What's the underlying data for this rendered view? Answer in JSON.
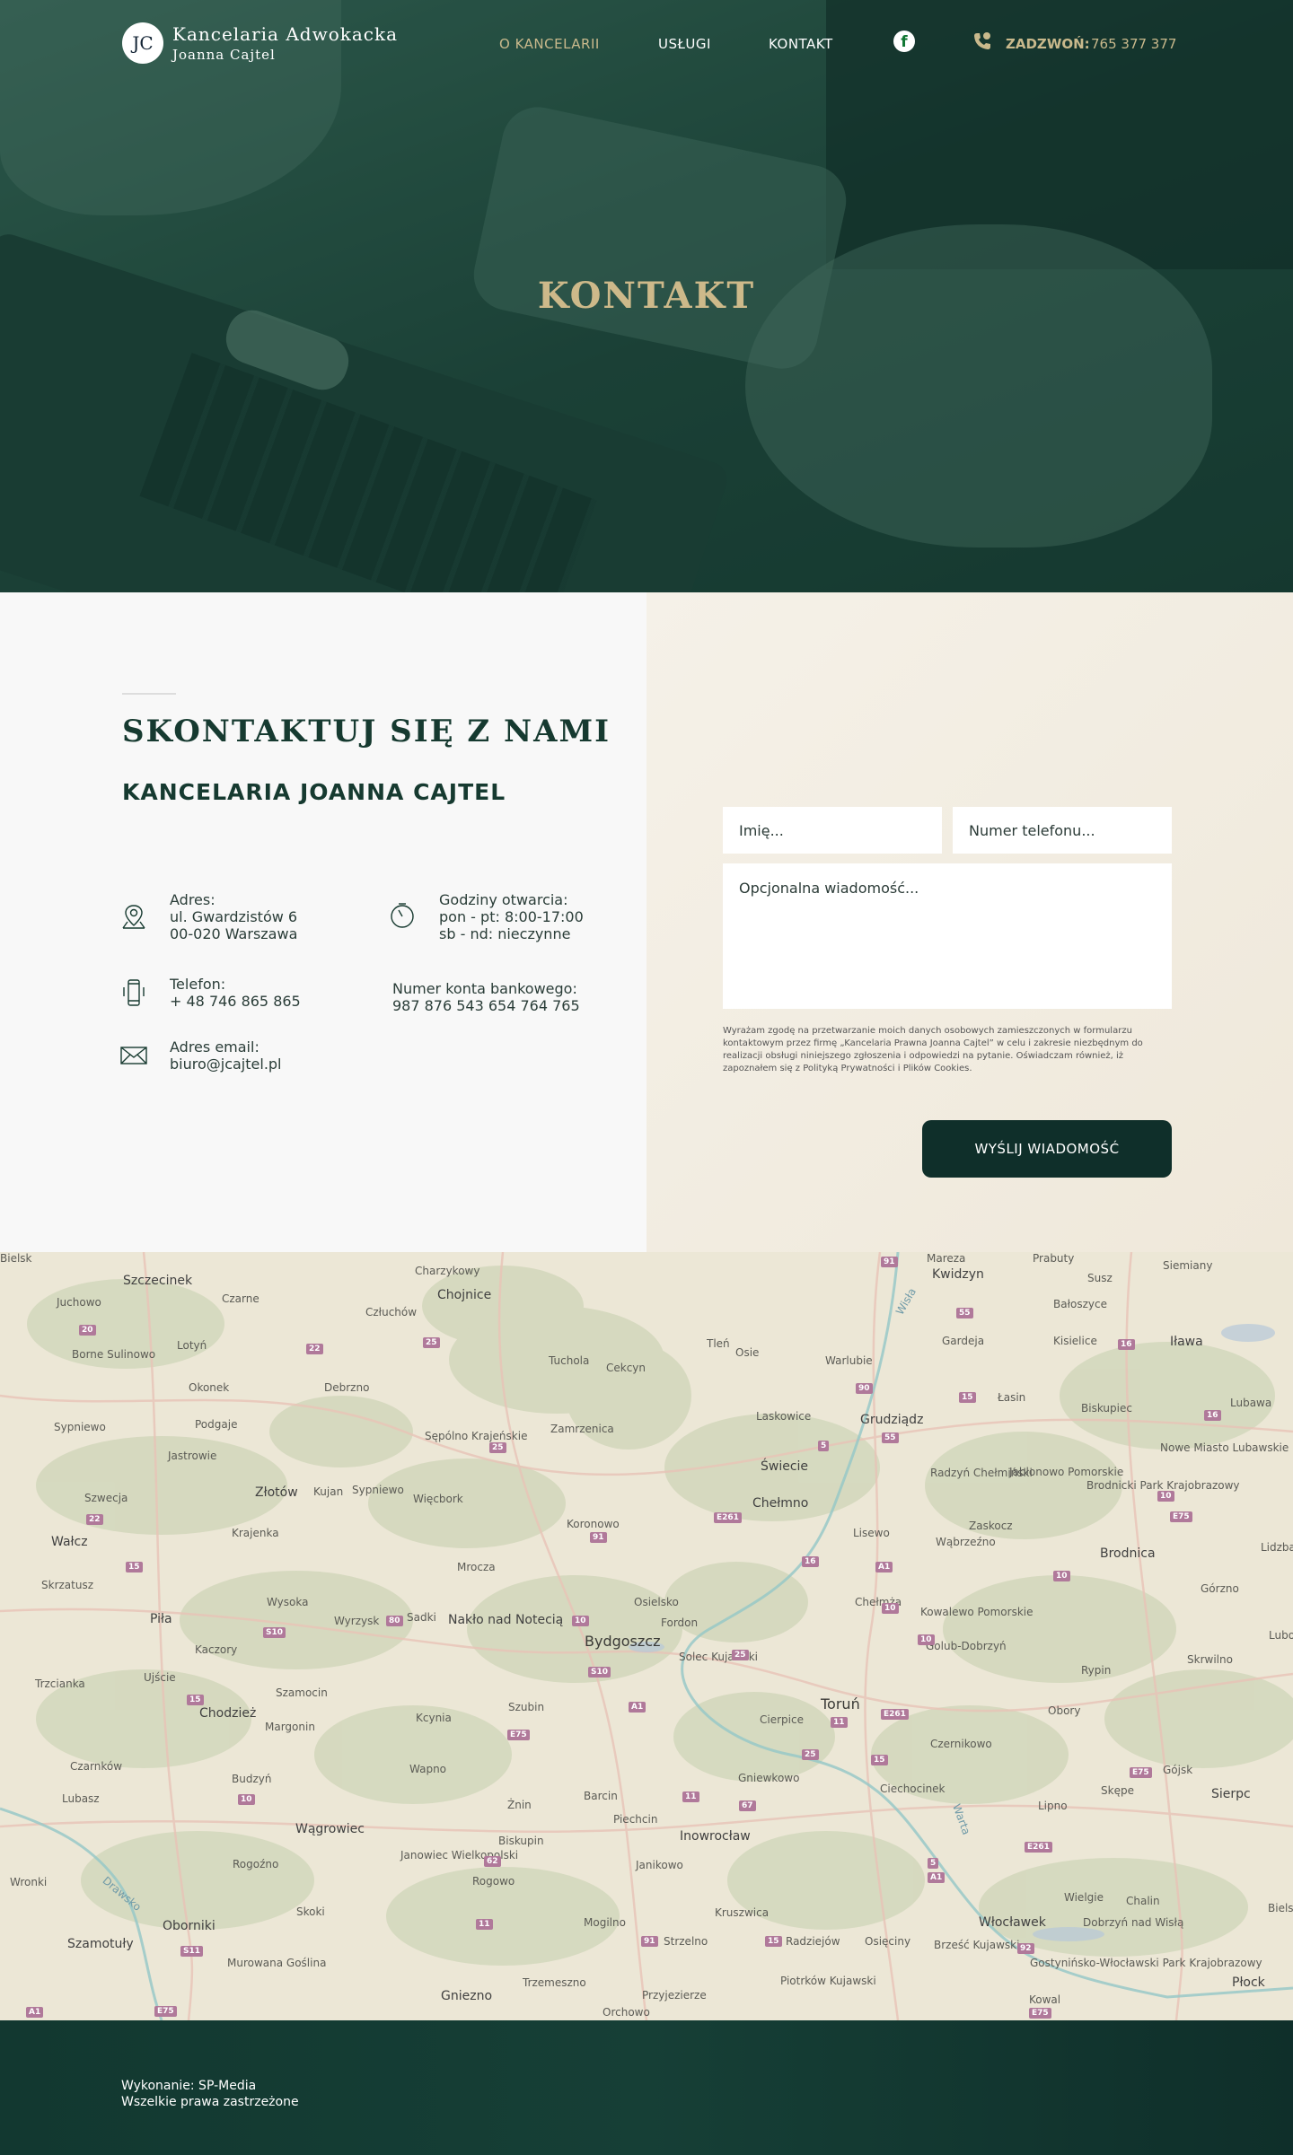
{
  "nav": {
    "logo_mark": "JC",
    "logo_line1": "Kancelaria Adwokacka",
    "logo_line2": "Joanna Cajtel",
    "links": [
      "O KANCELARII",
      "USŁUGI",
      "KONTAKT"
    ],
    "facebook_glyph": "f",
    "call_label": "ZADZWOŃ:",
    "call_number": "765 377 377"
  },
  "hero": {
    "title": "KONTAKT"
  },
  "contact": {
    "heading": "SKONTAKTUJ SIĘ Z NAMI",
    "subheading": "KANCELARIA JOANNA CAJTEL",
    "address_label": "Adres:",
    "address_line1": "ul. Gwardzistów 6",
    "address_line2": "00-020 Warszawa",
    "hours_label": "Godziny otwarcia:",
    "hours_line1": "pon - pt: 8:00-17:00",
    "hours_line2": "sb - nd: nieczynne",
    "phone_label": "Telefon:",
    "phone_value": "+ 48 746 865 865",
    "bank_label": "Numer konta bankowego:",
    "bank_value": "987 876 543 654 764 765",
    "email_label": "Adres email:",
    "email_value": "biuro@jcajtel.pl"
  },
  "form": {
    "name_placeholder": "Imię...",
    "phone_placeholder": "Numer telefonu...",
    "message_placeholder": "Opcjonalna wiadomość...",
    "consent": "Wyrażam zgodę na przetwarzanie moich danych osobowych zamieszczonych w formularzu kontaktowym przez firmę „Kancelaria Prawna Joanna Cajtel” w celu i zakresie niezbędnym do realizacji obsługi niniejszego zgłoszenia i odpowiedzi na pytanie. Oświadczam również, iż zapoznałem się z Polityką Prywatności i Plików Cookies.",
    "submit": "WYŚLIJ WIADOMOŚĆ"
  },
  "map": {
    "cities": [
      "Szczecinek",
      "Chojnice",
      "Człuchów",
      "Charzykowy",
      "Juchowo",
      "Czarne",
      "Borne Sulinowo",
      "Lotyń",
      "Debrzno",
      "Tuchola",
      "Cekcyn",
      "Tleń",
      "Osie",
      "Warlubie",
      "Kwidzyn",
      "Mareza",
      "Prabuty",
      "Susz",
      "Siemiany",
      "Bałoszyce",
      "Gardeja",
      "Kisielice",
      "Iława",
      "Okonek",
      "Sypniewo",
      "Podgaje",
      "Jastrowie",
      "Sępólno Krajeńskie",
      "Zamrzenica",
      "Laskowice",
      "Grudziądz",
      "Łasin",
      "Biskupiec",
      "Lubawa",
      "Nowe Miasto Lubawskie",
      "Szwecja",
      "Złotów",
      "Kujan",
      "Sypniewo",
      "Więcbork",
      "Świecie",
      "Chełmno",
      "Radzyń Chełmiński",
      "Jabłonowo Pomorskie",
      "Brodnicki Park Krajobrazowy",
      "Wałcz",
      "Krajenka",
      "Koronowo",
      "Lisewo",
      "Zaskocz",
      "Wąbrzeźno",
      "Brodnica",
      "Skrzatusz",
      "Mrocza",
      "Górzno",
      "Lidzbark",
      "Wysoka",
      "Osielsko",
      "Chełmża",
      "Kowalewo Pomorskie",
      "Piła",
      "Wyrzysk",
      "Sadki",
      "Nakło nad Notecią",
      "Bydgoszcz",
      "Fordon",
      "Golub-Dobrzyń",
      "Lubowidz",
      "Kaczory",
      "Solec Kujawski",
      "Rypin",
      "Skrwilno",
      "Trzcianka",
      "Ujście",
      "Szamocin",
      "Chodzież",
      "Kcynia",
      "Szubin",
      "Cierpice",
      "Toruń",
      "Obory",
      "Margonin",
      "Czernikowo",
      "Czarnków",
      "Wapno",
      "Gniewkowo",
      "Ciechocinek",
      "Gójsk",
      "Lubasz",
      "Budzyń",
      "Barcin",
      "Lipno",
      "Skępe",
      "Sierpc",
      "Wągrowiec",
      "Żnin",
      "Piechcin",
      "Inowrocław",
      "Biskupin",
      "Rogoźno",
      "Janowiec Wielkopolski",
      "Rogowo",
      "Janikowo",
      "Wielgie",
      "Chalin",
      "Wronki",
      "Skoki",
      "Kruszwica",
      "Dobrzyń nad Wisłą",
      "Oborniki",
      "Mogilno",
      "Strzelno",
      "Radziejów",
      "Osięciny",
      "Włocławek",
      "Szamotuły",
      "Brześć Kujawski",
      "Gostynińsko-Włocławski Park Krajobrazowy",
      "Murowana Goślina",
      "Trzemeszno",
      "Piotrków Kujawski",
      "Kowal",
      "Płock",
      "Gniezno",
      "Przyjezierze",
      "Orchowo",
      "Wisła",
      "Warta",
      "Drawsko",
      "Bielsk"
    ],
    "roads": [
      "91",
      "55",
      "20",
      "22",
      "25",
      "16",
      "16",
      "15",
      "90",
      "55",
      "5",
      "25",
      "10",
      "E261",
      "22",
      "91",
      "E75",
      "16",
      "A1",
      "15",
      "10",
      "10",
      "10",
      "10",
      "80",
      "S10",
      "25",
      "S10",
      "A1",
      "11",
      "E261",
      "15",
      "E75",
      "25",
      "15",
      "11",
      "67",
      "10",
      "E261",
      "E75",
      "62",
      "5",
      "15",
      "11",
      "91",
      "S11",
      "92",
      "E75",
      "A1"
    ]
  },
  "footer": {
    "line1": "Wykonanie: SP-Media",
    "line2": "Wszelkie prawa zastrzeżone"
  }
}
